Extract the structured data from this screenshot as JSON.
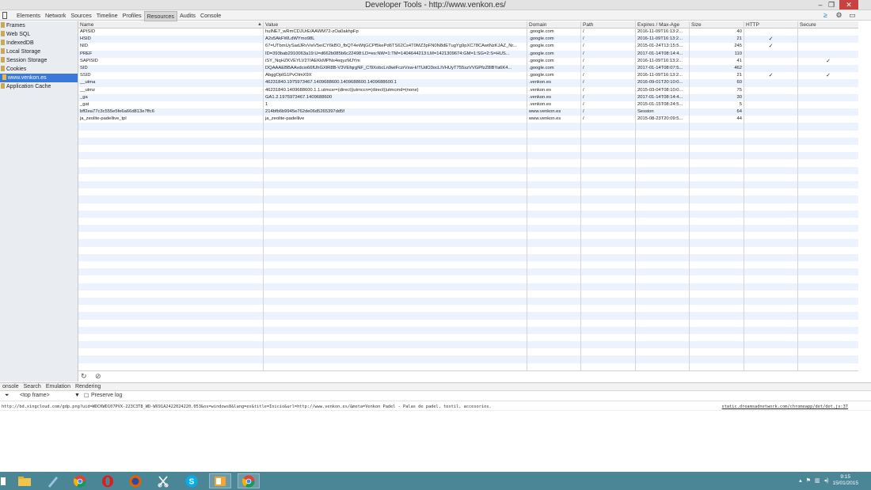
{
  "window": {
    "title": "Developer Tools - http://www.venkon.es/"
  },
  "tabs": [
    "Elements",
    "Network",
    "Sources",
    "Timeline",
    "Profiles",
    "Resources",
    "Audits",
    "Console"
  ],
  "active_tab": "Resources",
  "sidebar": {
    "items": [
      {
        "label": "Frames"
      },
      {
        "label": "Web SQL"
      },
      {
        "label": "IndexedDB"
      },
      {
        "label": "Local Storage"
      },
      {
        "label": "Session Storage"
      },
      {
        "label": "Cookies"
      },
      {
        "label": "www.venkon.es"
      },
      {
        "label": "Application Cache"
      }
    ]
  },
  "table": {
    "headers": {
      "name": "Name",
      "value": "Value",
      "domain": "Domain",
      "path": "Path",
      "expires": "Expires / Max-Age",
      "size": "Size",
      "http": "HTTP",
      "secure": "Secure"
    },
    "rows": [
      {
        "name": "APISID",
        "value": "hulNE7_wRmCDJUrE/AAWM72-zOa0akhpFp",
        "domain": ".google.com",
        "path": "/",
        "expires": "2016-11-09T16:13:2...",
        "size": "40",
        "http": "",
        "secure": ""
      },
      {
        "name": "HSID",
        "value": "A2s5AkFWLdWYmo98L",
        "domain": ".google.com",
        "path": "/",
        "expires": "2016-11-09T16:13:2...",
        "size": "21",
        "http": "✓",
        "secure": ""
      },
      {
        "name": "NID",
        "value": "67=UTbmUySadJRvVwV5eiCY6kBO_fbQT4eWtjGCPf5kePd6TS62Cs4T0MZ3pFN0N8dETugYg9pXC78CAwtNzKJAZ_Nr...",
        "domain": ".google.com",
        "path": "/",
        "expires": "2015-01-24T13:15:5...",
        "size": "245",
        "http": "✓",
        "secure": ""
      },
      {
        "name": "PREF",
        "value": "ID=393bab2910063a19:U=d662b085b6c22498:LD=es:NW=1:TM=1404644213:LM=1421309674:GM=1:SG=2:S=HUS...",
        "domain": ".google.com",
        "path": "/",
        "expires": "2017-01-14T08:14:4...",
        "size": "110",
        "http": "",
        "secure": ""
      },
      {
        "name": "SAPISID",
        "value": "iSY_NqHZKVEYLV27/AEKkMPNs4eqyzMJYm",
        "domain": ".google.com",
        "path": "/",
        "expires": "2016-11-09T16:13:2...",
        "size": "41",
        "http": "",
        "secure": "✓"
      },
      {
        "name": "SID",
        "value": "DQAAAEBBAAvdcio66fUhGXlR8B-V3VEfqrgNF_C!9XobcLn9wiFczrVsw-k!TUdO3ocLIVHUyT755szVVGPfzZ8lBYa6K4...",
        "domain": ".google.com",
        "path": "/",
        "expires": "2017-01-14T08:07:5...",
        "size": "462",
        "http": "",
        "secure": ""
      },
      {
        "name": "SSID",
        "value": "AbggOplG1PvOlmX9X",
        "domain": ".google.com",
        "path": "/",
        "expires": "2016-11-09T16:13:2...",
        "size": "21",
        "http": "✓",
        "secure": "✓"
      },
      {
        "name": "__utma",
        "value": "46231840.1975973467.1409688600.1409688600.1409688600.1",
        "domain": ".venkon.es",
        "path": "/",
        "expires": "2016-09-01T20:10:0...",
        "size": "60",
        "http": "",
        "secure": ""
      },
      {
        "name": "__utmz",
        "value": "46231840.1409688600.1.1.utmcsr=(direct)|utmccn=(direct)|utmcmd=(none)",
        "domain": ".venkon.es",
        "path": "/",
        "expires": "2015-03-04T08:10:0...",
        "size": "75",
        "http": "",
        "secure": ""
      },
      {
        "name": "_ga",
        "value": "GA1.2.1975973467.1409688600",
        "domain": ".venkon.es",
        "path": "/",
        "expires": "2017-01-14T08:14:4...",
        "size": "30",
        "http": "",
        "secure": ""
      },
      {
        "name": "_gat",
        "value": "1",
        "domain": ".venkon.es",
        "path": "/",
        "expires": "2015-01-15T08:24:5...",
        "size": "5",
        "http": "",
        "secure": ""
      },
      {
        "name": "bff2ea77c3c555e5fe6a66d813e7ffc6",
        "value": "214bfb6b9945e762de06d5265397dd5f",
        "domain": "www.venkon.es",
        "path": "/",
        "expires": "Session",
        "size": "64",
        "http": "",
        "secure": ""
      },
      {
        "name": "ja_zeolite-padellive_tpl",
        "value": "ja_zeolite-padellive",
        "domain": "www.venkon.es",
        "path": "/",
        "expires": "2015-08-23T20:09:5...",
        "size": "44",
        "http": "",
        "secure": ""
      }
    ]
  },
  "drawer": {
    "tabs": [
      "onsole",
      "Search",
      "Emulation",
      "Rendering"
    ],
    "frame_select": "<top frame>",
    "preserve_log": "Preserve log",
    "console_message": "http://bd.xingcloud.com/gdp.png?uid=WDCKWD107PVX-223C3T8_WD-WX91A2422024220.053&os=windows8&lang=es&title=Inicio&url=http://www.venkon.es/&meta=Venkon Padel - Palas de padel, textil, accesorios.",
    "console_source": "static.dreamsadnetwork.com/chromeapp/det/det.js:37"
  },
  "taskbar": {
    "time": "9:15",
    "date": "15/01/2015"
  },
  "colors": {
    "selected": "#3879d9",
    "row_stripe": "#edf3fe",
    "taskbar": "#4b8696"
  }
}
